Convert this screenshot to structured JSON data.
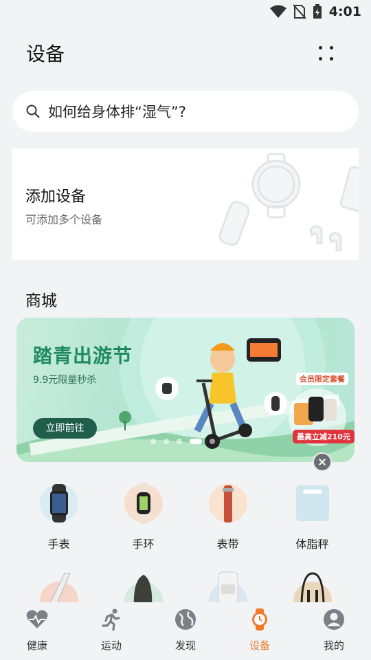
{
  "status_bar": {
    "time": "4:01"
  },
  "header": {
    "title": "设备"
  },
  "search": {
    "placeholder": "如何给身体排“湿气”?"
  },
  "add_device": {
    "title": "添加设备",
    "subtitle": "可添加多个设备"
  },
  "shop": {
    "title": "商城",
    "banner": {
      "title": "踏青出游节",
      "subtitle": "9.9元限量秒杀",
      "button_label": "立即前往",
      "member_tag": "会员限定套餐",
      "promo_tag": "最高立减210元",
      "active_slide": 4,
      "slide_count": 5
    }
  },
  "categories": [
    {
      "label": "手表",
      "icon": "smartwatch-icon"
    },
    {
      "label": "手环",
      "icon": "band-icon"
    },
    {
      "label": "表带",
      "icon": "strap-icon"
    },
    {
      "label": "体脂秤",
      "icon": "scale-icon"
    },
    {
      "label": "",
      "icon": "treadmill-icon"
    },
    {
      "label": "",
      "icon": "massage-chair-icon"
    },
    {
      "label": "",
      "icon": "glucose-meter-icon"
    },
    {
      "label": "",
      "icon": "jump-rope-icon"
    }
  ],
  "tabbar": {
    "items": [
      {
        "label": "健康",
        "icon": "heart-icon"
      },
      {
        "label": "运动",
        "icon": "running-icon"
      },
      {
        "label": "发现",
        "icon": "globe-icon"
      },
      {
        "label": "设备",
        "icon": "watch-icon",
        "active": true
      },
      {
        "label": "我的",
        "icon": "profile-icon"
      }
    ]
  },
  "colors": {
    "accent": "#f07a29",
    "banner_green": "#1e8a63",
    "background": "#f1f3f5"
  }
}
